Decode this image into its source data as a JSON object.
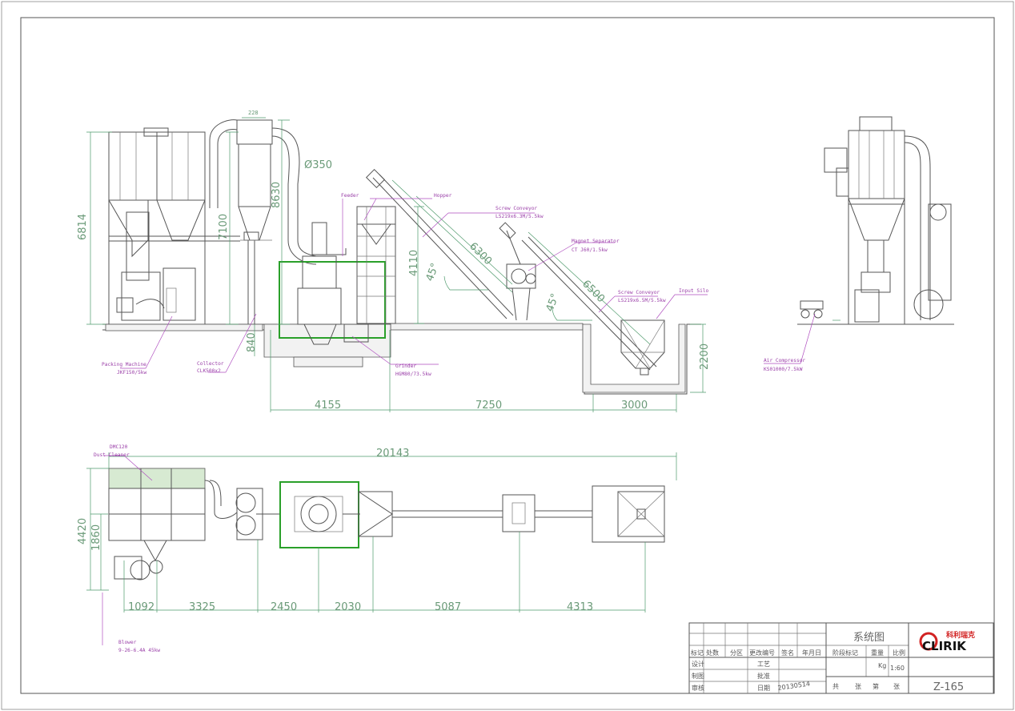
{
  "dimensions": {
    "d6814": "6814",
    "d7100": "7100",
    "d8630": "8630",
    "d4110": "4110",
    "d840": "840",
    "d2200": "2200",
    "d4155": "4155",
    "d7250": "7250",
    "d3000": "3000",
    "d6300": "6300",
    "d6500": "6500",
    "ang1": "45°",
    "ang2": "45°",
    "dia350": "Ø350",
    "d228": "228",
    "d20143": "20143",
    "d4420": "4420",
    "d1860": "1860",
    "d1092": "1092",
    "d3325": "3325",
    "d2450": "2450",
    "d2030": "2030",
    "d5087": "5087",
    "d4313": "4313"
  },
  "labels": {
    "feeder": "Feeder",
    "hopper": "Hopper",
    "screw1_title": "Screw Conveyor",
    "screw1_spec": "LS219x6.3M/5.5kw",
    "magnet_title": "Magnet Separator",
    "magnet_spec": "CT J60/1.5kw",
    "screw2_title": "Screw Conveyor",
    "screw2_spec": "LS219x6.5M/5.5kw",
    "silo": "Input Silo",
    "packing_title": "Packing Machine",
    "packing_spec": "JKF150/5kw",
    "collector_title": "Collector",
    "collector_spec": "CLK500x2",
    "grinder_title": "Grinder",
    "grinder_spec": "HGM80/73.5kw",
    "air_title": "Air Compressor",
    "air_spec": "KS01000/7.5kW",
    "dust_model": "DMC120",
    "dust_title": "Dust Cleaner",
    "blower_title": "Blower",
    "blower_spec": "9-26-6.4A 45kw"
  },
  "title_block": {
    "row1": [
      "标记",
      "处数",
      "分区",
      "更改编号",
      "签名",
      "年月日"
    ],
    "row2": [
      "设计",
      "工艺"
    ],
    "row3": [
      "制图",
      "批准"
    ],
    "row4": [
      "审核",
      "日期"
    ],
    "date": "20130514",
    "drawing_name": "系统图",
    "stage": "阶段标记",
    "weight": "重量",
    "scale_label": "比例",
    "unit": "Kg",
    "scale": "1:60",
    "sheets": [
      "共",
      "张",
      "第",
      "张"
    ],
    "drawing_no": "Z-165",
    "logo_cn": "科利瑞克",
    "logo_en": "CLIRIK"
  },
  "colors": {
    "dimension": "#4f9a6c",
    "leader": "#b04fc0",
    "grinder_frame": "#2aa02a",
    "logo_red": "#d22222"
  }
}
